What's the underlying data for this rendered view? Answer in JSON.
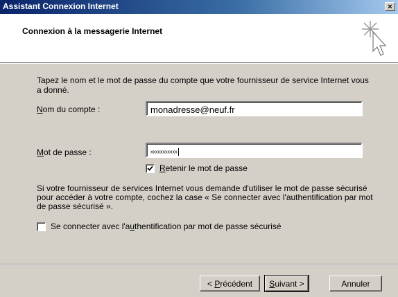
{
  "window": {
    "title": "Assistant Connexion Internet",
    "close_label": "×"
  },
  "header": {
    "title": "Connexion à la messagerie Internet",
    "icon": "wizard-starburst-cursor-icon"
  },
  "form": {
    "description": "Tapez le nom et le mot de passe du compte que votre fournisseur de service Internet vous a donné.",
    "account_label_u": "N",
    "account_label_rest": "om du compte :",
    "account_value": "monadresse@neuf.fr",
    "password_label_u": "M",
    "password_label_rest": "ot de passe :",
    "password_value": "xxxxxxxxxxx",
    "remember_label_u": "R",
    "remember_label_rest": "etenir le mot de passe",
    "remember_checked": true,
    "spa_info": "Si votre fournisseur de services Internet vous demande d'utiliser le mot de passe sécurisé pour accéder à votre compte, cochez la case « Se connecter avec l'authentification par mot de passe sécurisé ».",
    "spa_label_pre": "Se connecter avec l'a",
    "spa_label_u": "u",
    "spa_label_post": "thentification par mot de passe sécurisé",
    "spa_checked": false
  },
  "buttons": {
    "back_pre": "< ",
    "back_u": "P",
    "back_post": "récédent",
    "next_u": "S",
    "next_post": "uivant >",
    "cancel": "Annuler"
  }
}
